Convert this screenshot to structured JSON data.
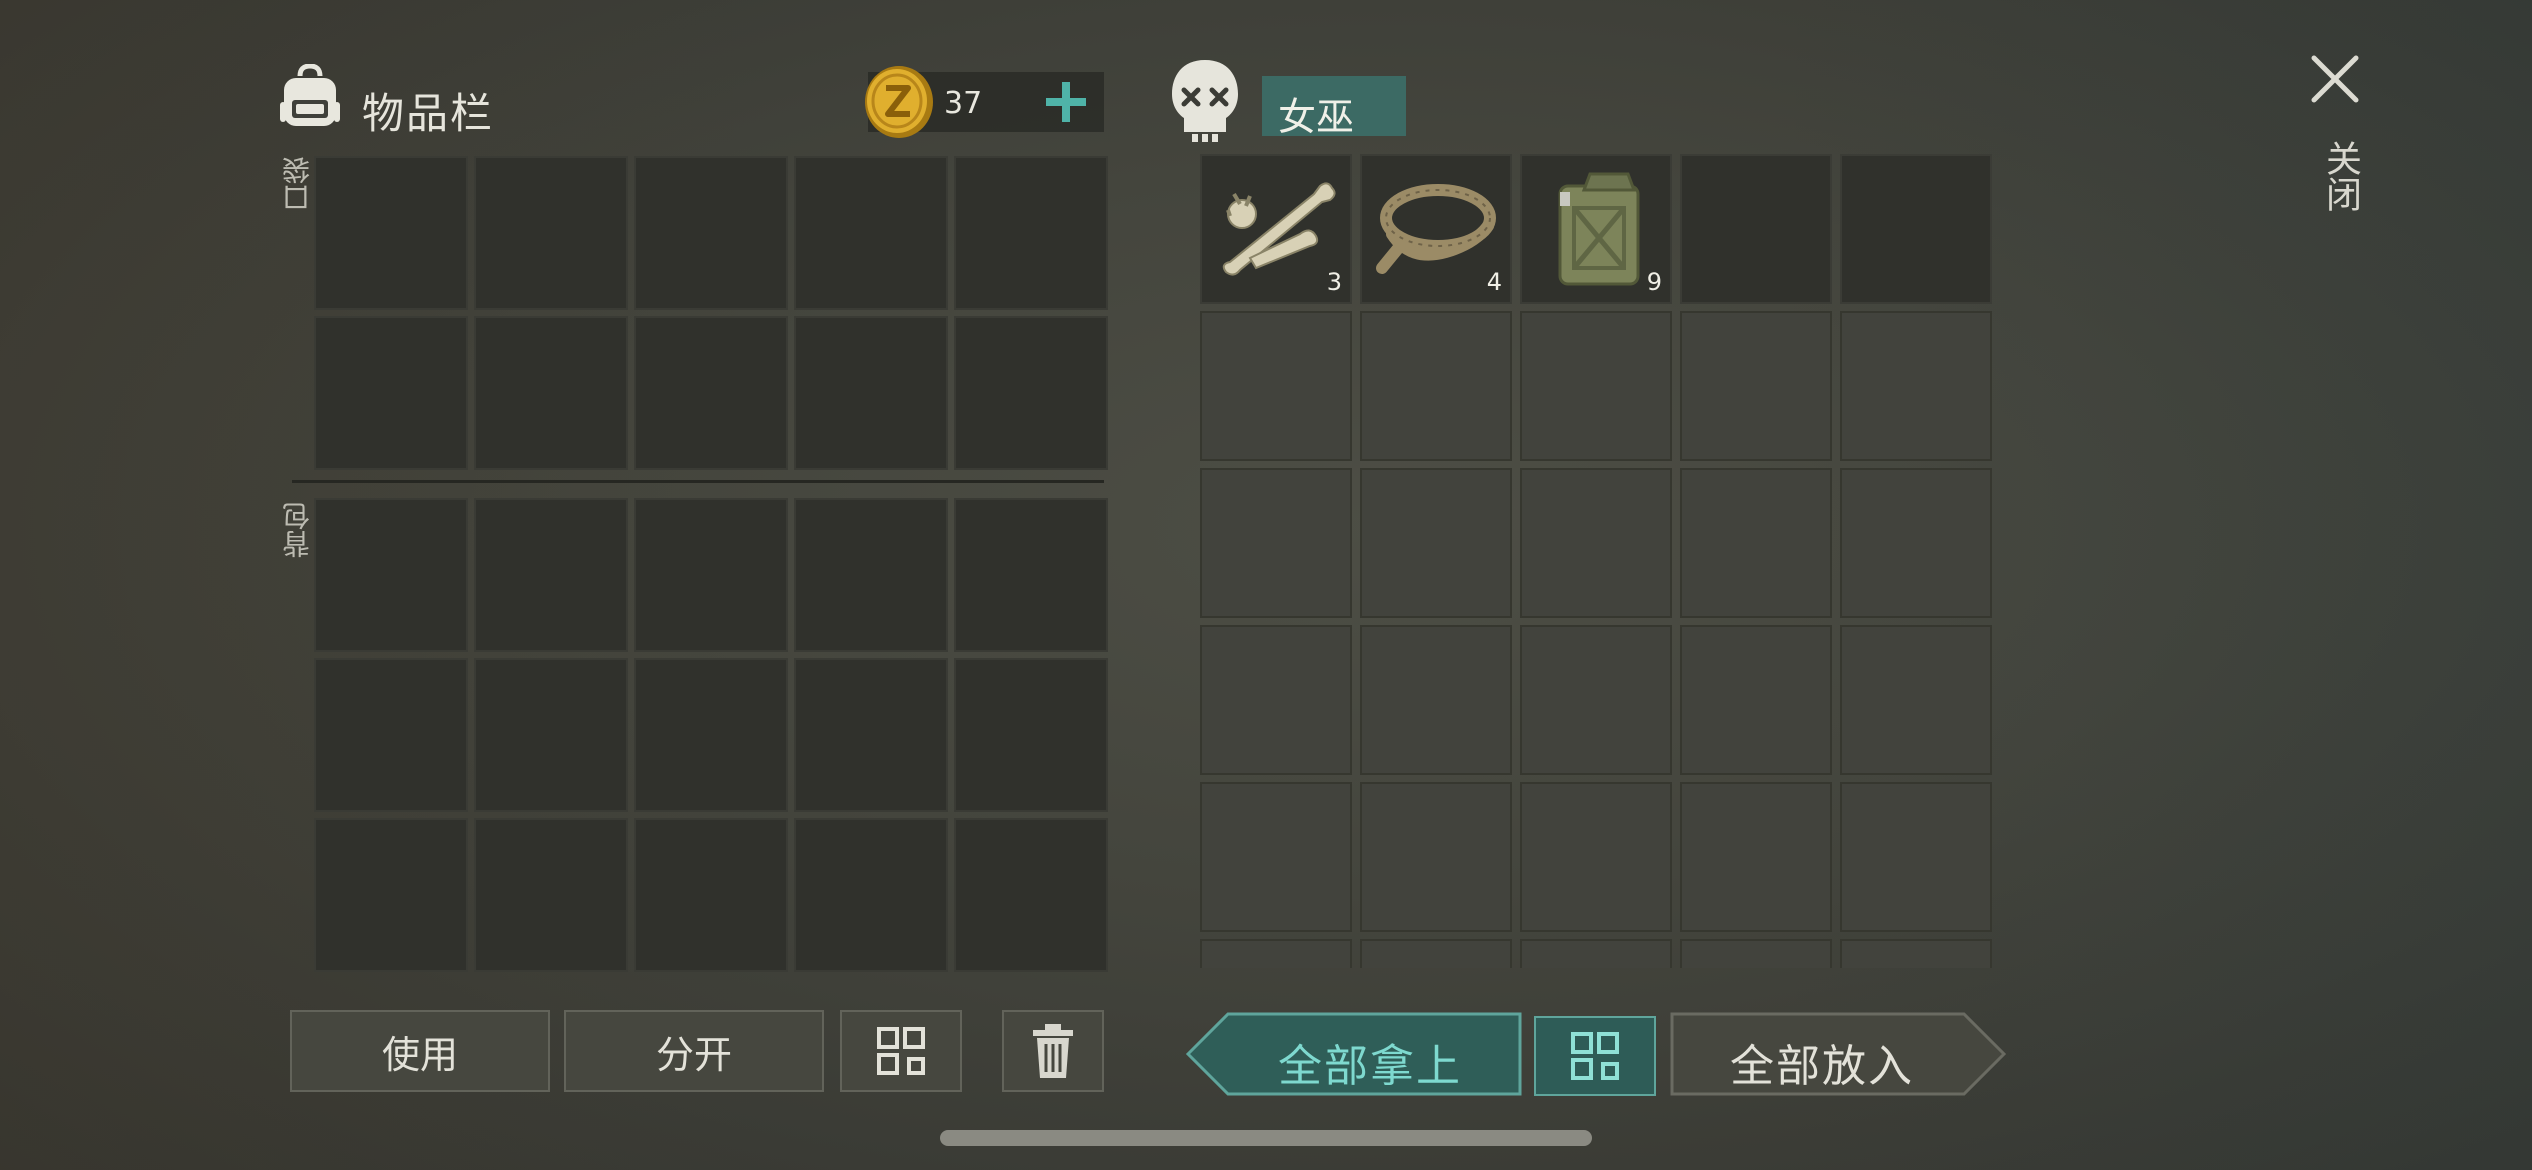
{
  "inventory": {
    "title": "物品栏",
    "coins": "37",
    "pocket_label": "口袋",
    "backpack_label": "背包",
    "pocket_rows": 2,
    "pocket_cols": 5,
    "backpack_rows": 3,
    "backpack_cols": 5
  },
  "loot": {
    "name": "女巫",
    "items": [
      {
        "icon": "bones-icon",
        "count": "3"
      },
      {
        "icon": "rope-icon",
        "count": "4"
      },
      {
        "icon": "jerry-can-icon",
        "count": "9"
      }
    ]
  },
  "close": {
    "label": "关闭"
  },
  "actions": {
    "use": "使用",
    "split": "分开",
    "take_all": "全部拿上",
    "put_all": "全部放入"
  },
  "colors": {
    "accent": "#3c6a64",
    "accent_text": "#7ed9cf",
    "coin": "#d8a628"
  }
}
